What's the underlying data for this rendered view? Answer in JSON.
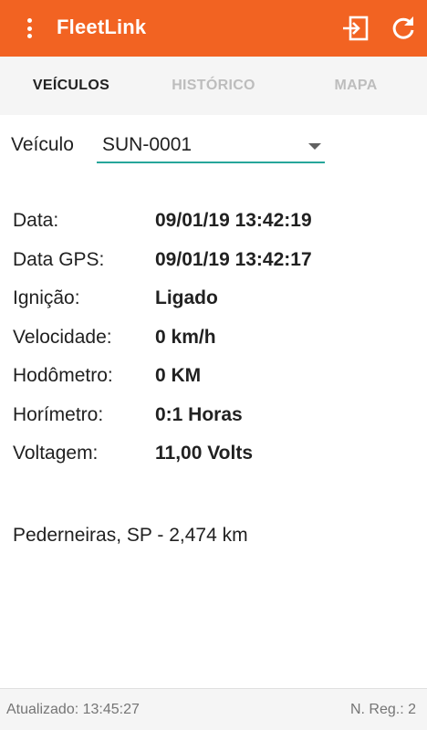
{
  "app": {
    "title": "FleetLink"
  },
  "colors": {
    "appbar": "#f26322",
    "accent_underline": "#26a69a"
  },
  "icons": {
    "menu": "more-vert-icon",
    "login": "login-icon",
    "refresh": "refresh-icon"
  },
  "tabs": [
    {
      "label": "VEÍCULOS",
      "active": true
    },
    {
      "label": "HISTÓRICO",
      "active": false
    },
    {
      "label": "MAPA",
      "active": false
    }
  ],
  "vehicle_selector": {
    "label": "Veículo",
    "value": "SUN-0001"
  },
  "info": {
    "rows": [
      {
        "key": "Data:",
        "value": "09/01/19 13:42:19"
      },
      {
        "key": "Data GPS:",
        "value": "09/01/19 13:42:17"
      },
      {
        "key": "Ignição:",
        "value": "Ligado"
      },
      {
        "key": "Velocidade:",
        "value": "0 km/h"
      },
      {
        "key": "Hodômetro:",
        "value": "0 KM"
      },
      {
        "key": "Horímetro:",
        "value": "0:1 Horas"
      },
      {
        "key": "Voltagem:",
        "value": "11,00 Volts"
      }
    ]
  },
  "location": "Pederneiras, SP - 2,474 km",
  "footer": {
    "updated": "Atualizado: 13:45:27",
    "reg_count": "N. Reg.: 2"
  }
}
